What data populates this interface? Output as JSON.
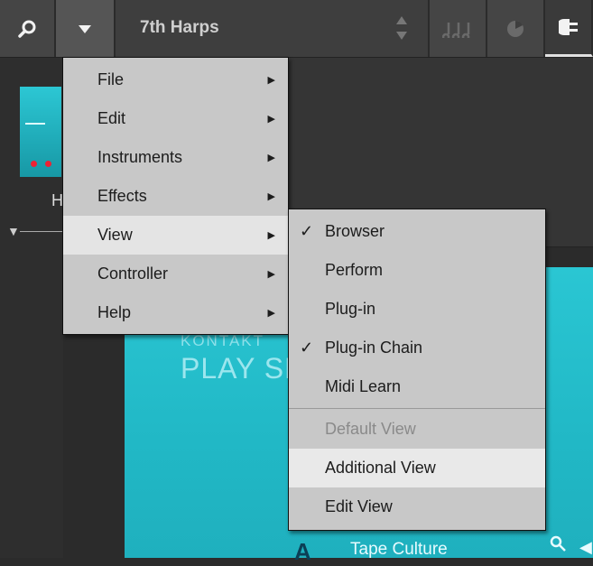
{
  "toolbar": {
    "title": "7th Harps",
    "icons": [
      "search-icon",
      "dropdown-icon",
      "up-down-icon",
      "notes-icon",
      "dial-icon",
      "plugin-icon"
    ]
  },
  "sidebar": {
    "label": "H"
  },
  "instrument": {
    "brand_small": "KONTAKT",
    "brand_big": "PLAY SERIES",
    "logo": "A",
    "preset": "Tape Culture"
  },
  "main_menu": {
    "items": [
      {
        "label": "File",
        "has_submenu": true
      },
      {
        "label": "Edit",
        "has_submenu": true
      },
      {
        "label": "Instruments",
        "has_submenu": true
      },
      {
        "label": "Effects",
        "has_submenu": true
      },
      {
        "label": "View",
        "has_submenu": true
      },
      {
        "label": "Controller",
        "has_submenu": true
      },
      {
        "label": "Help",
        "has_submenu": true
      }
    ]
  },
  "view_menu": {
    "items": [
      {
        "label": "Browser",
        "checked": true
      },
      {
        "label": "Perform",
        "checked": false
      },
      {
        "label": "Plug-in",
        "checked": false
      },
      {
        "label": "Plug-in Chain",
        "checked": true
      },
      {
        "label": "Midi Learn",
        "checked": false
      },
      {
        "label": "Default View",
        "disabled": true
      },
      {
        "label": "Additional View"
      },
      {
        "label": "Edit View"
      }
    ]
  },
  "colors": {
    "accent": "#26bfcc",
    "menu_bg": "#c8c8c8",
    "highlight": "#e4e4e4"
  }
}
